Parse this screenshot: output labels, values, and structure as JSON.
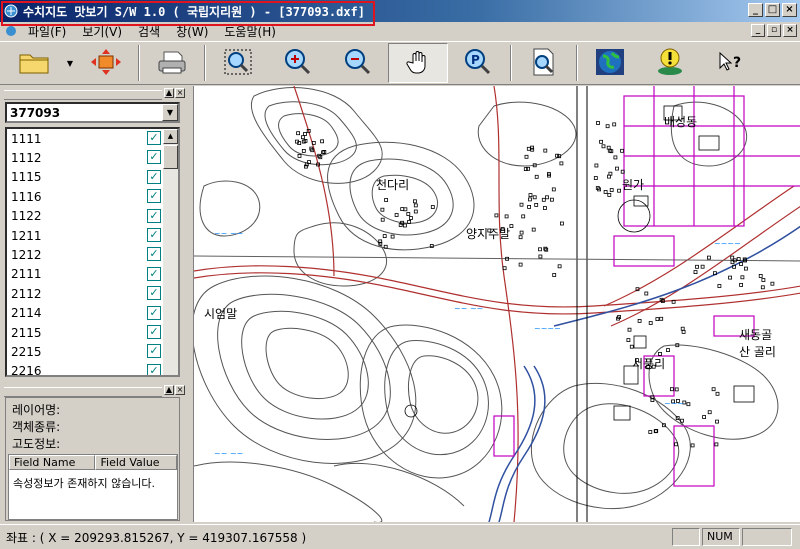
{
  "window": {
    "title": "수치지도 맛보기 S/W  1.0 ( 국립지리원 ) - [377093.dxf]",
    "min": "_",
    "max": "□",
    "close": "×",
    "restore": "▫"
  },
  "menu": [
    "파일(F)",
    "보기(V)",
    "검색",
    "창(W)",
    "도움말(H)"
  ],
  "toolbar": [
    "open-folder",
    "layer-arrange",
    "print",
    "zoom-window",
    "zoom-in",
    "zoom-out",
    "pan-hand",
    "pan-p",
    "info-query",
    "globe",
    "alert-pin",
    "help-query"
  ],
  "layers": {
    "selected": "377093",
    "items": [
      "1111",
      "1112",
      "1115",
      "1116",
      "1122",
      "1211",
      "1212",
      "2111",
      "2112",
      "2114",
      "2115",
      "2215",
      "2216"
    ],
    "checked": "☑"
  },
  "info": {
    "layer_name": "레이어명:",
    "object_type": "객체종류:",
    "elevation": "고도정보:",
    "col_field_name": "Field Name",
    "col_field_value": "Field Value",
    "no_attr": "속성정보가 존재하지 않습니다."
  },
  "map_labels": [
    "천다리",
    "양지주말",
    "배성동",
    "원가",
    "시엄말",
    "새동골",
    "산 골리",
    "서풍리"
  ],
  "status": {
    "coord": "좌표 : ( X = 209293.815267, Y = 419307.167558 )",
    "num": "NUM"
  }
}
